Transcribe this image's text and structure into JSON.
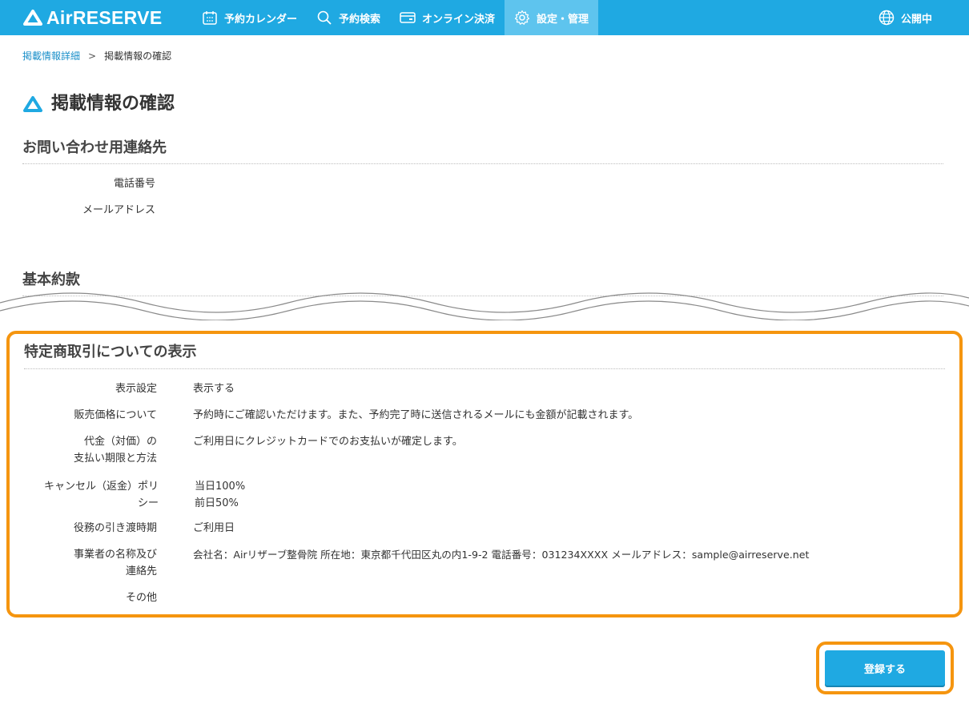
{
  "app": {
    "logo_text": "AirRESERVE"
  },
  "nav": {
    "items": [
      {
        "label": "予約カレンダー",
        "icon": "calendar-icon"
      },
      {
        "label": "予約検索",
        "icon": "search-icon"
      },
      {
        "label": "オンライン決済",
        "icon": "wallet-icon"
      },
      {
        "label": "設定・管理",
        "icon": "gear-icon",
        "active": true
      }
    ],
    "status_label": "公開中"
  },
  "breadcrumb": {
    "parent": "掲載情報詳細",
    "separator": ">",
    "current": "掲載情報の確認"
  },
  "page": {
    "title": "掲載情報の確認"
  },
  "contact": {
    "title": "お問い合わせ用連絡先",
    "rows": [
      {
        "label": "電話番号",
        "value": ""
      },
      {
        "label": "メールアドレス",
        "value": ""
      }
    ]
  },
  "terms": {
    "title": "基本約款"
  },
  "commerce": {
    "title": "特定商取引についての表示",
    "rows": [
      {
        "label": [
          "表示設定"
        ],
        "value": [
          "表示する"
        ]
      },
      {
        "label": [
          "販売価格について"
        ],
        "value": [
          "予約時にご確認いただけます。また、予約完了時に送信されるメールにも金額が記載されます。"
        ]
      },
      {
        "label": [
          "代金（対価）の",
          "支払い期限と方法"
        ],
        "value": [
          "ご利用日にクレジットカードでのお支払いが確定します。"
        ]
      },
      {
        "label": [
          "キャンセル（返金）ポリ",
          "シー"
        ],
        "value": [
          "当日100%",
          "前日50%"
        ]
      },
      {
        "label": [
          "役務の引き渡時期"
        ],
        "value": [
          "ご利用日"
        ]
      },
      {
        "label": [
          "事業者の名称及び",
          "連絡先"
        ],
        "value": [
          "会社名：Airリザーブ整骨院 所在地：東京都千代田区丸の内1-9-2 電話番号：031234XXXX メールアドレス：sample@airreserve.net"
        ]
      },
      {
        "label": [
          "その他"
        ],
        "value": [
          ""
        ]
      }
    ]
  },
  "actions": {
    "register_label": "登録する"
  },
  "colors": {
    "brand": "#1fa9e2",
    "highlight": "#f5950f",
    "link": "#1a8fc9"
  }
}
